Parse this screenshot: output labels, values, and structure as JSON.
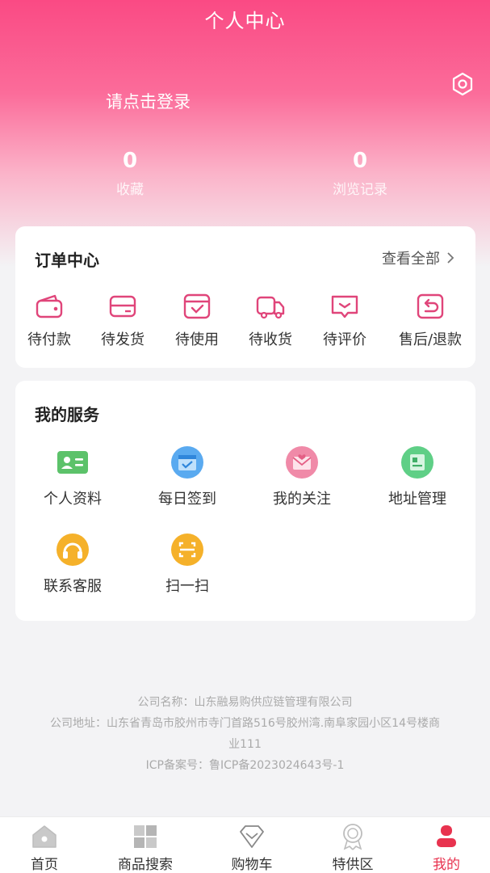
{
  "header": {
    "title": "个人中心",
    "login_text": "请点击登录",
    "stats": {
      "favorites_count": "0",
      "favorites_label": "收藏",
      "history_count": "0",
      "history_label": "浏览记录"
    }
  },
  "orders": {
    "title": "订单中心",
    "view_all": "查看全部",
    "items": [
      {
        "label": "待付款",
        "icon": "wallet-icon"
      },
      {
        "label": "待发货",
        "icon": "card-icon"
      },
      {
        "label": "待使用",
        "icon": "check-box-icon"
      },
      {
        "label": "待收货",
        "icon": "truck-icon"
      },
      {
        "label": "待评价",
        "icon": "comment-icon"
      },
      {
        "label": "售后/退款",
        "icon": "return-icon"
      }
    ]
  },
  "services": {
    "title": "我的服务",
    "items": [
      {
        "label": "个人资料",
        "icon": "id-card-icon",
        "color": "#5cc26a"
      },
      {
        "label": "每日签到",
        "icon": "calendar-icon",
        "color": "#5aaaf0"
      },
      {
        "label": "我的关注",
        "icon": "envelope-heart-icon",
        "color": "#f08aa8"
      },
      {
        "label": "地址管理",
        "icon": "address-icon",
        "color": "#5fcf86"
      },
      {
        "label": "联系客服",
        "icon": "headset-icon",
        "color": "#f5b12a"
      },
      {
        "label": "扫一扫",
        "icon": "scan-icon",
        "color": "#f5b12a"
      }
    ]
  },
  "footer": {
    "company_name": "公司名称：山东融易购供应链管理有限公司",
    "company_address_line1": "公司地址：山东省青岛市胶州市寺门首路516号胶州湾.南阜家园小区14号楼商",
    "company_address_line2": "业111",
    "icp": "ICP备案号：鲁ICP备2023024643号-1"
  },
  "tabbar": {
    "items": [
      {
        "label": "首页",
        "icon": "home-icon"
      },
      {
        "label": "商品搜索",
        "icon": "grid-icon"
      },
      {
        "label": "购物车",
        "icon": "heart-diamond-icon"
      },
      {
        "label": "特供区",
        "icon": "medal-icon"
      },
      {
        "label": "我的",
        "icon": "user-icon",
        "active": true
      }
    ]
  },
  "colors": {
    "brand_pink": "#fa4a84",
    "order_icon": "#e0457a",
    "active_tab": "#e8334f"
  }
}
